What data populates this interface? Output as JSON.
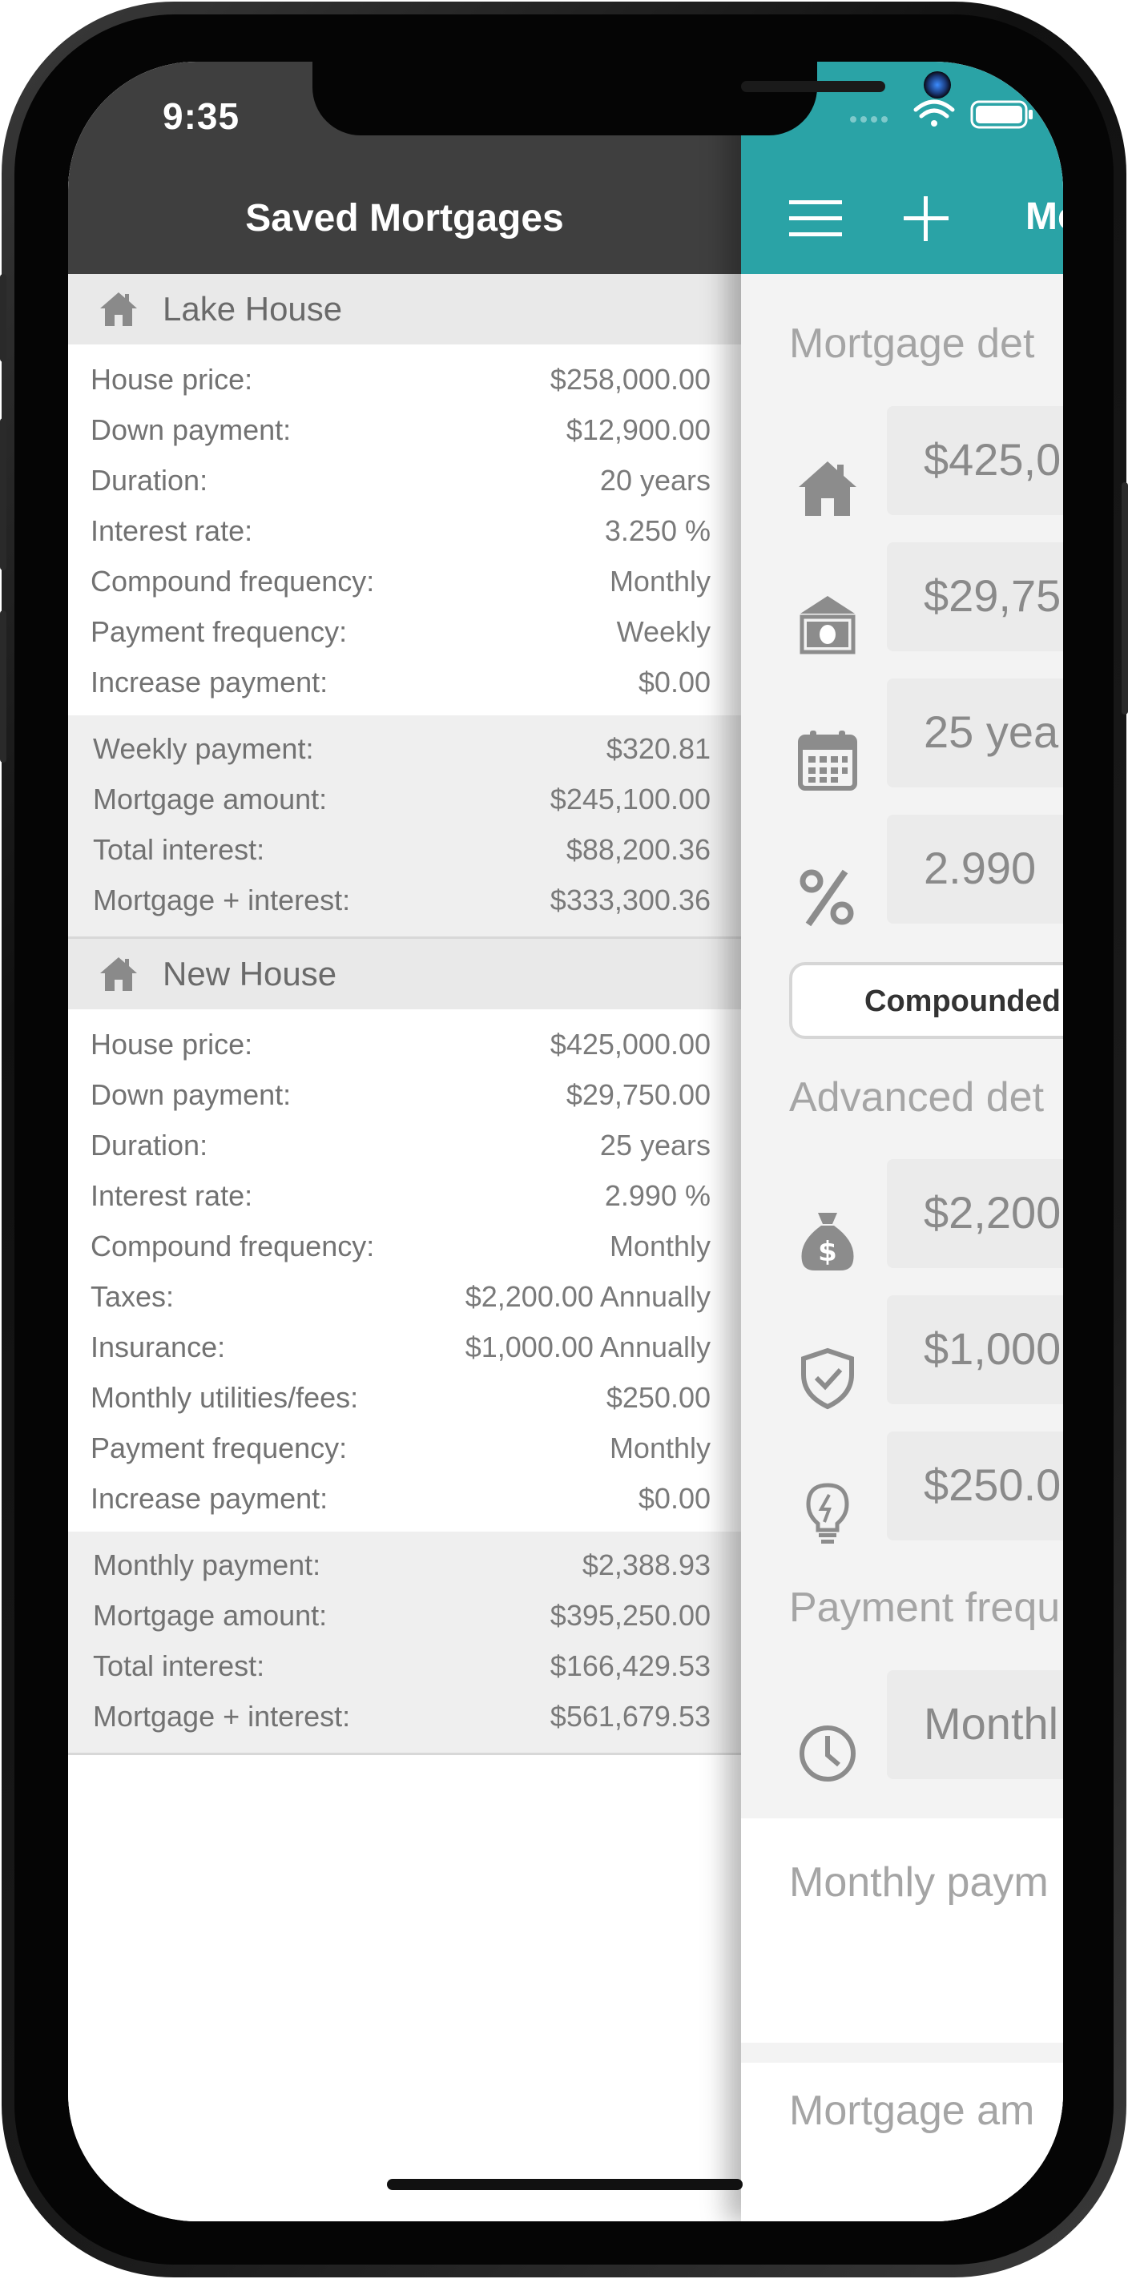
{
  "status_bar": {
    "time": "9:35"
  },
  "left_panel": {
    "title": "Saved Mortgages",
    "mortgages": [
      {
        "name": "Lake House",
        "details": [
          {
            "label": "House price:",
            "value": "$258,000.00"
          },
          {
            "label": "Down payment:",
            "value": "$12,900.00"
          },
          {
            "label": "Duration:",
            "value": "20 years"
          },
          {
            "label": "Interest rate:",
            "value": "3.250 %"
          },
          {
            "label": "Compound frequency:",
            "value": "Monthly"
          },
          {
            "label": "Payment frequency:",
            "value": "Weekly"
          },
          {
            "label": "Increase payment:",
            "value": "$0.00"
          }
        ],
        "summary": [
          {
            "label": "Weekly payment:",
            "value": "$320.81"
          },
          {
            "label": "Mortgage amount:",
            "value": "$245,100.00"
          },
          {
            "label": "Total interest:",
            "value": "$88,200.36"
          },
          {
            "label": "Mortgage + interest:",
            "value": "$333,300.36"
          }
        ]
      },
      {
        "name": "New House",
        "details": [
          {
            "label": "House price:",
            "value": "$425,000.00"
          },
          {
            "label": "Down payment:",
            "value": "$29,750.00"
          },
          {
            "label": "Duration:",
            "value": "25 years"
          },
          {
            "label": "Interest rate:",
            "value": "2.990 %"
          },
          {
            "label": "Compound frequency:",
            "value": "Monthly"
          },
          {
            "label": "Taxes:",
            "value": "$2,200.00 Annually"
          },
          {
            "label": "Insurance:",
            "value": "$1,000.00 Annually"
          },
          {
            "label": "Monthly utilities/fees:",
            "value": "$250.00"
          },
          {
            "label": "Payment frequency:",
            "value": "Monthly"
          },
          {
            "label": "Increase payment:",
            "value": "$0.00"
          }
        ],
        "summary": [
          {
            "label": "Monthly payment:",
            "value": "$2,388.93"
          },
          {
            "label": "Mortgage amount:",
            "value": "$395,250.00"
          },
          {
            "label": "Total interest:",
            "value": "$166,429.53"
          },
          {
            "label": "Mortgage + interest:",
            "value": "$561,679.53"
          }
        ]
      }
    ]
  },
  "right_panel": {
    "header_title": "Mo",
    "section_mortgage_details": "Mortgage det",
    "field_house_price": "$425,0",
    "field_down_payment": "$29,75",
    "field_duration": "25 yea",
    "field_interest_rate": "2.990",
    "compound_segment_label": "Compounded",
    "section_advanced_details": "Advanced det",
    "field_taxes": "$2,200",
    "field_insurance": "$1,000",
    "field_utilities": "$250.0",
    "section_payment_frequency": "Payment frequ",
    "field_payment_frequency": "Monthl",
    "result_monthly_payment": "Monthly paym",
    "result_mortgage_amount": "Mortgage am"
  },
  "colors": {
    "accent": "#2aa3a6",
    "left_header": "#3f3f3f"
  }
}
